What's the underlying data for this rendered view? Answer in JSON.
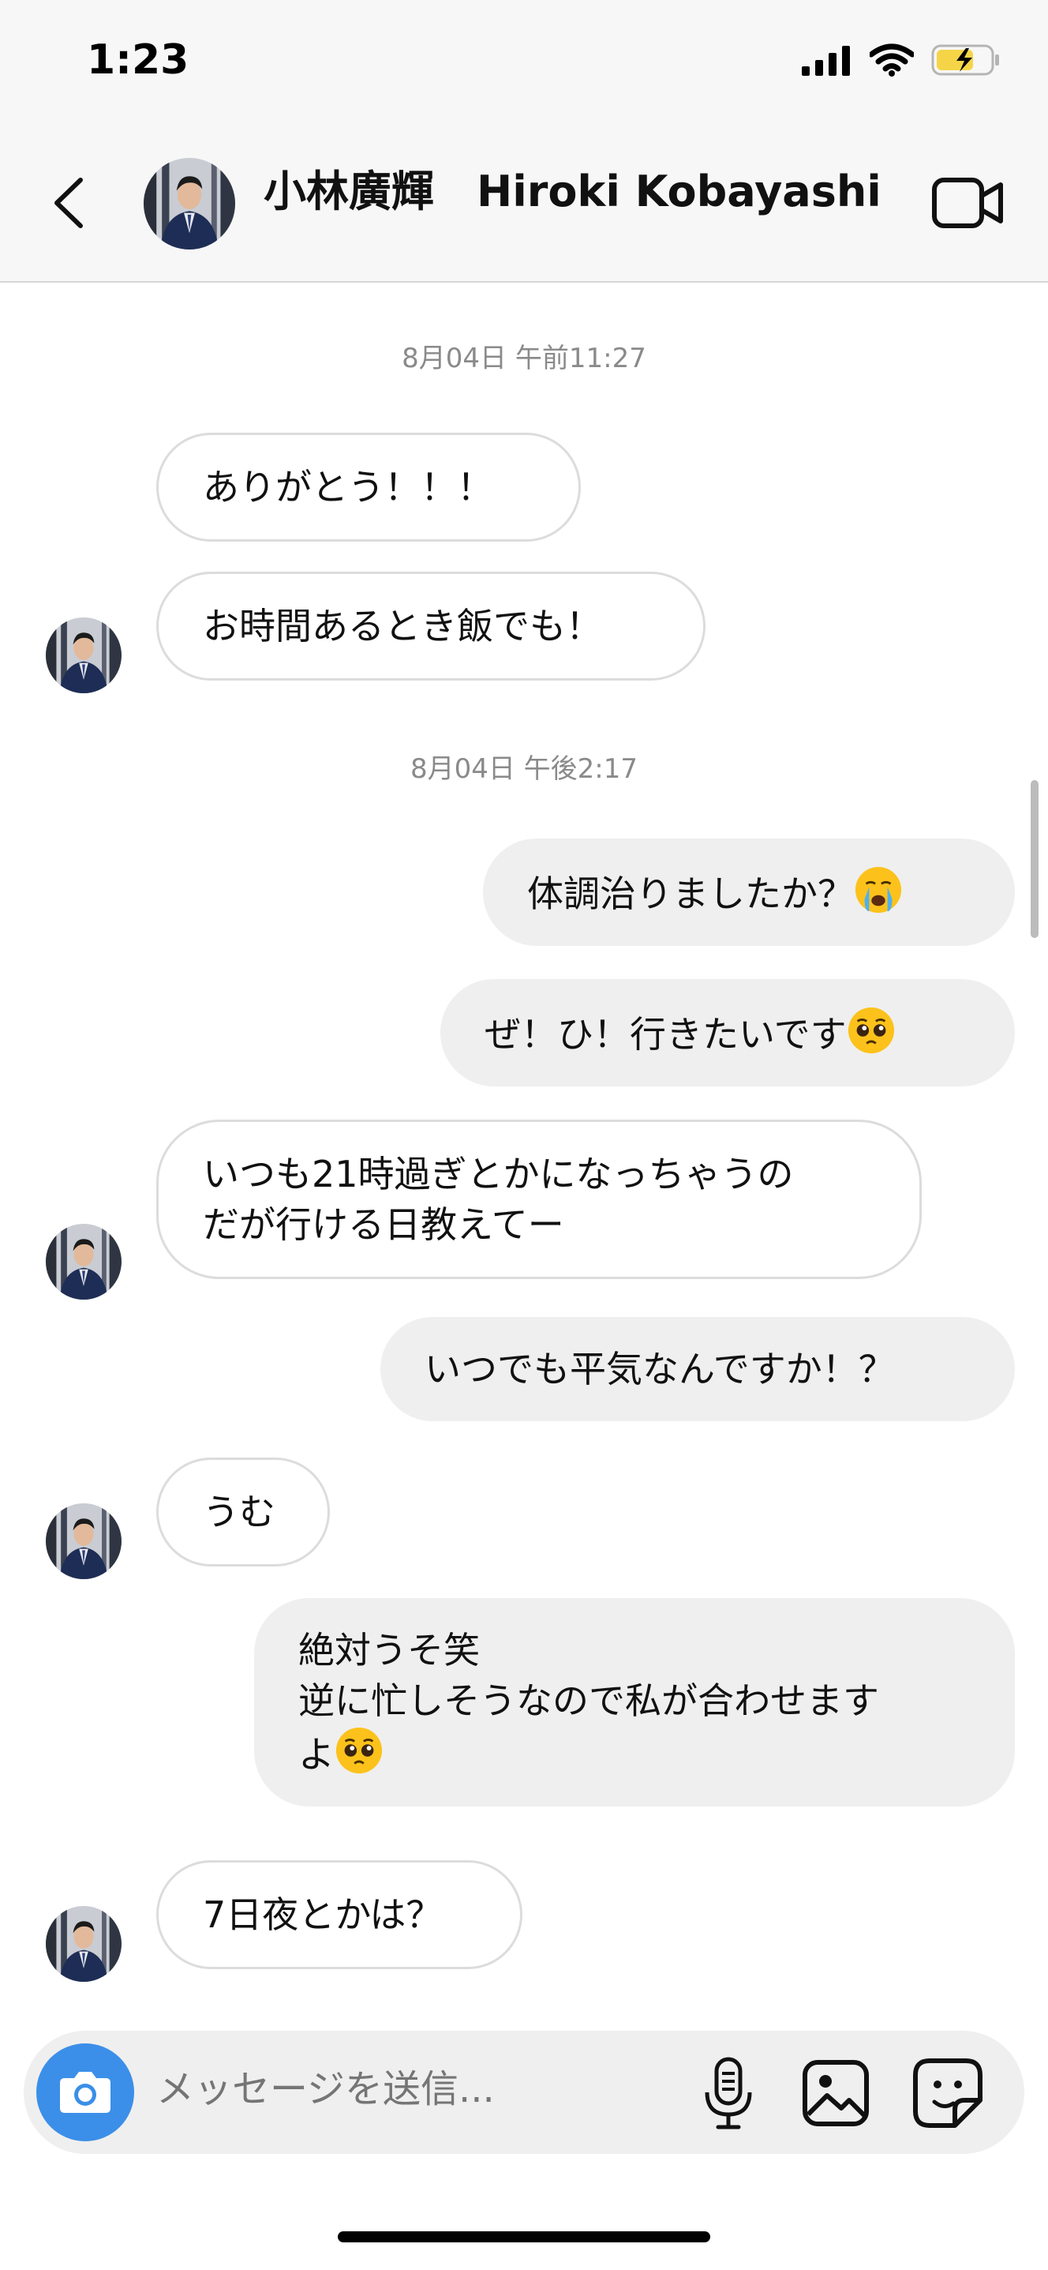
{
  "status_bar": {
    "time": "1:23"
  },
  "header": {
    "name": "小林廣輝　Hiroki Kobayashi"
  },
  "chat": {
    "timestamps": [
      "8月04日 午前11:27",
      "8月04日 午後2:17"
    ],
    "messages": [
      {
        "side": "received",
        "text": "ありがとう！！！"
      },
      {
        "side": "received",
        "text": "お時間あるとき飯でも！"
      },
      {
        "side": "sent",
        "text": "体調治りましたか？",
        "emoji": "crying-face-emoji"
      },
      {
        "side": "sent",
        "text": "ぜ！ひ！行きたいです",
        "emoji": "pleading-face-emoji"
      },
      {
        "side": "received",
        "text_lines": [
          "いつも21時過ぎとかになっちゃうの",
          "だが行ける日教えてー"
        ]
      },
      {
        "side": "sent",
        "text": "いつでも平気なんですか！？"
      },
      {
        "side": "received",
        "text": "うむ"
      },
      {
        "side": "sent",
        "text_lines": [
          "絶対うそ笑",
          "逆に忙しそうなので私が合わせます",
          "よ"
        ],
        "emoji": "pleading-face-emoji"
      },
      {
        "side": "received",
        "text": "7日夜とかは？"
      }
    ]
  },
  "composer": {
    "placeholder": "メッセージを送信..."
  },
  "icons": {
    "back": "chevron-left-icon",
    "video": "video-camera-icon",
    "camera": "camera-icon",
    "mic": "microphone-icon",
    "gallery": "image-icon",
    "sticker": "sticker-icon"
  },
  "colors": {
    "camera_button": "#3b8fe8",
    "sent_bubble": "#efefef",
    "battery": "#f5d547"
  }
}
